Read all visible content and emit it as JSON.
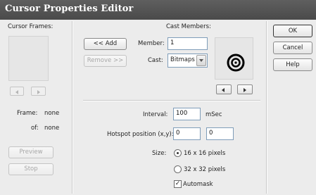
{
  "window": {
    "title": "Cursor Properties Editor"
  },
  "cursor_frames": {
    "heading": "Cursor Frames:",
    "frame_label": "Frame:",
    "frame_value": "none",
    "of_label": "of:",
    "of_value": "none",
    "preview_button": "Preview",
    "stop_button": "Stop"
  },
  "cast_members": {
    "heading": "Cast Members:",
    "add_button": "<< Add",
    "remove_button": "Remove >>",
    "member_label": "Member:",
    "member_value": "1",
    "cast_label": "Cast:",
    "cast_value": "Bitmaps"
  },
  "settings": {
    "interval_label": "Interval:",
    "interval_value": "100",
    "interval_unit": "mSec",
    "hotspot_label": "Hotspot position (x,y):",
    "hotspot_x": "0",
    "hotspot_y": "0",
    "size_label": "Size:",
    "size_option_1": "16 x 16 pixels",
    "size_option_2": "32 x 32 pixels",
    "automask_label": "Automask",
    "size_selected": "16 x 16 pixels",
    "automask_checked": true
  },
  "dialog_buttons": {
    "ok": "OK",
    "cancel": "Cancel",
    "help": "Help"
  }
}
